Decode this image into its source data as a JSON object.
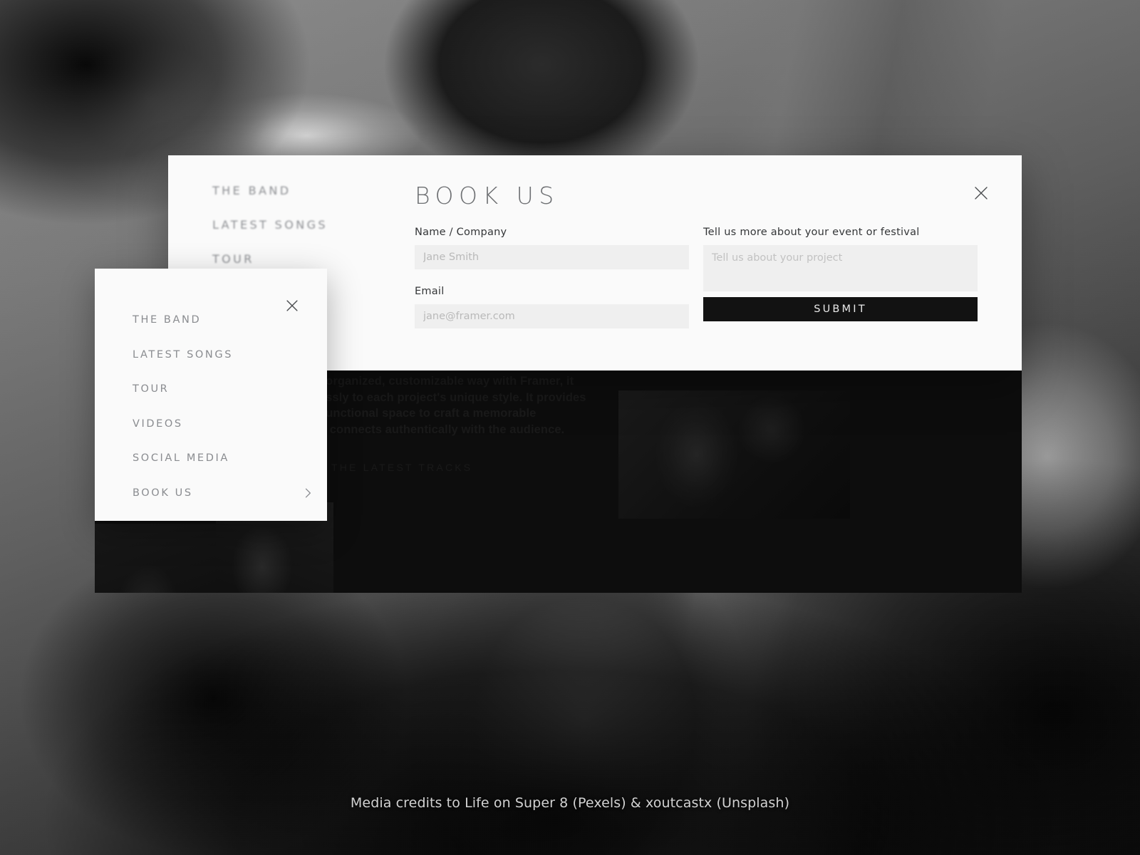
{
  "background": {
    "description": "Grayscale live concert photograph of a band performing with crowd"
  },
  "content_panel": {
    "paragraph": "an organized, customizable way with Framer, it\nnlessly to each project's unique style. It provides\ne, functional space to craft a memorable\nhat connects authentically with the audience.",
    "tracks_label": "THE LATEST TRACKS"
  },
  "modal": {
    "title": "BOOK US",
    "close_icon": "close-icon",
    "ghost_nav": [
      {
        "label": "THE BAND"
      },
      {
        "label": "LATEST SONGS"
      },
      {
        "label": "TOUR"
      }
    ],
    "form": {
      "name_label": "Name / Company",
      "name_placeholder": "Jane Smith",
      "name_value": "",
      "email_label": "Email",
      "email_placeholder": "jane@framer.com",
      "email_value": "",
      "message_label": "Tell us more about your event or festival",
      "message_placeholder": "Tell us about your project",
      "message_value": "",
      "submit_label": "SUBMIT"
    }
  },
  "menu_panel": {
    "close_icon": "close-icon",
    "items": [
      {
        "label": "THE BAND",
        "chevron": false
      },
      {
        "label": "LATEST SONGS",
        "chevron": false
      },
      {
        "label": "TOUR",
        "chevron": false
      },
      {
        "label": "VIDEOS",
        "chevron": false
      },
      {
        "label": "SOCIAL MEDIA",
        "chevron": false
      },
      {
        "label": "BOOK US",
        "chevron": true
      }
    ]
  },
  "footer": {
    "credits": "Media credits to Life on Super 8 (Pexels) & xoutcastx (Unsplash)"
  },
  "colors": {
    "panel_bg": "#fafafa",
    "dark_panel": "#0d0d0d",
    "input_bg": "#efefef",
    "submit_bg": "#121212",
    "label_text": "#343638",
    "muted_text": "#8a8c90"
  }
}
